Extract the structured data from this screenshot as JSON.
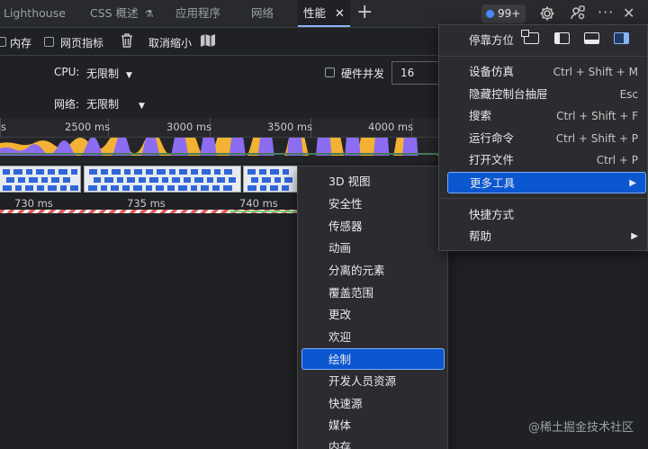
{
  "tabs": [
    {
      "label": "Lighthouse"
    },
    {
      "label": "CSS 概述"
    },
    {
      "label": "应用程序"
    },
    {
      "label": "网络"
    },
    {
      "label": "性能",
      "active": true
    }
  ],
  "issues_badge": "99+",
  "toolbar": {
    "memory_label": "内存",
    "web_vitals_label": "网页指标",
    "cancel_zoom_label": "取消缩小",
    "cpu_label": "CPU:",
    "cpu_value": "无限制",
    "network_label": "网络:",
    "network_value": "无限制",
    "hw_concurrency_label": "硬件并发",
    "hw_concurrency_value": "16"
  },
  "timeline": {
    "overview_ticks": [
      "s",
      "2500 ms",
      "3000 ms",
      "3500 ms",
      "4000 ms"
    ],
    "detail_ticks": [
      "730 ms",
      "735 ms",
      "740 ms"
    ]
  },
  "main_menu": {
    "dock_label": "停靠方位",
    "items": [
      {
        "label": "设备仿真",
        "shortcut": "Ctrl + Shift + M"
      },
      {
        "label": "隐藏控制台抽屉",
        "shortcut": "Esc"
      },
      {
        "label": "搜索",
        "shortcut": "Ctrl + Shift + F"
      },
      {
        "label": "运行命令",
        "shortcut": "Ctrl + Shift + P"
      },
      {
        "label": "打开文件",
        "shortcut": "Ctrl + P"
      },
      {
        "label": "更多工具",
        "shortcut": ""
      },
      {
        "label": "快捷方式",
        "shortcut": ""
      },
      {
        "label": "帮助",
        "shortcut": ""
      }
    ]
  },
  "more_tools_menu": {
    "items": [
      "3D 视图",
      "安全性",
      "传感器",
      "动画",
      "分离的元素",
      "覆盖范围",
      "更改",
      "欢迎",
      "绘制",
      "开发人员资源",
      "快速源",
      "媒体",
      "内存"
    ],
    "highlighted": "绘制"
  },
  "watermark": "@稀土掘金技术社区",
  "colors": {
    "accent": "#0b57d0",
    "tab_underline": "#8ab4f8",
    "issue_dot": "#4a8cff",
    "cpu_scripting": "#f2b233",
    "cpu_rendering": "#8c6cf1"
  },
  "icons": [
    "beaker-icon",
    "close-icon",
    "plus-icon",
    "settings-gear-icon",
    "customize-people-icon",
    "more-vertical-icon",
    "trash-icon",
    "map-icon",
    "chevron-right-icon",
    "dock-icons"
  ]
}
